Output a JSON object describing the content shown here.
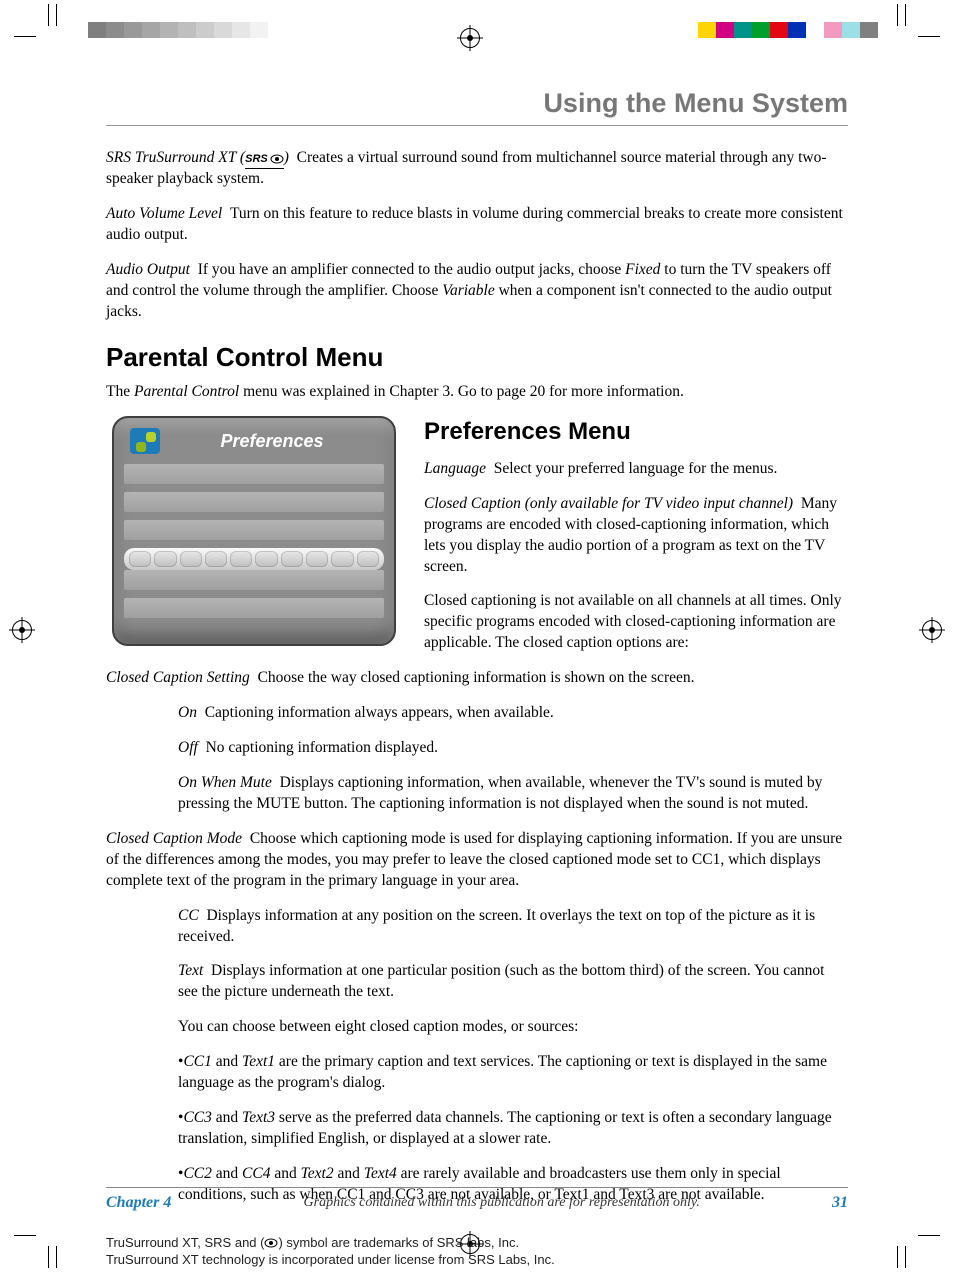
{
  "header": {
    "title": "Using the Menu System"
  },
  "top": {
    "srs_lead": "SRS TruSurround XT (",
    "srs_logo_text": "SRS",
    "srs_tail": ")",
    "srs_body": "Creates a virtual surround sound from multichannel source material through any two-speaker playback system.",
    "avl_lead": "Auto Volume Level",
    "avl_body": "Turn on this feature to reduce blasts in volume during commercial breaks to create more consistent audio output.",
    "ao_lead": "Audio Output",
    "ao_body1": "If you have an amplifier connected to the audio output jacks, choose ",
    "ao_fixed": "Fixed",
    "ao_body2": " to turn the TV speakers off and control the volume through the amplifier. Choose ",
    "ao_variable": "Variable",
    "ao_body3": " when a component isn't connected to the audio output jacks."
  },
  "parental": {
    "heading": "Parental Control Menu",
    "p1a": "The ",
    "p1b": "Parental Control",
    "p1c": " menu was explained in Chapter 3. Go to page 20 for more information."
  },
  "osd": {
    "title": "Preferences"
  },
  "prefs": {
    "heading": "Preferences Menu",
    "lang_lead": "Language",
    "lang_body": "Select your preferred language for the menus.",
    "cc_lead": "Closed Caption (only available for TV video input channel)",
    "cc_body": "Many programs are encoded with closed-captioning information, which lets you display the audio portion of a program as text on the TV screen.",
    "cc_p2": "Closed captioning is not available on all channels at all times. Only specific programs encoded with closed-captioning information are applicable. The closed caption options are:"
  },
  "ccset": {
    "lead": "Closed Caption Setting",
    "body": "Choose the way closed captioning information is shown on the screen.",
    "on_lead": "On",
    "on_body": "Captioning information always appears, when available.",
    "off_lead": "Off",
    "off_body": "No captioning information displayed.",
    "owm_lead": "On When Mute",
    "owm_body": "Displays captioning information, when available, whenever the TV's sound is muted by pressing the MUTE button. The captioning information is not displayed when the sound is not muted."
  },
  "ccmode": {
    "lead": "Closed Caption Mode",
    "body": "Choose which captioning mode is used for displaying captioning information. If you are unsure of the differences among the modes, you may prefer to leave the closed captioned mode set to CC1, which displays complete text of the program in the primary language in your area.",
    "cc_lead": "CC",
    "cc_body": "Displays information at any position on the screen. It overlays the text on top of the picture as it is received.",
    "text_lead": "Text",
    "text_body": "Displays information at one particular position (such as the bottom third) of the screen. You cannot see the picture underneath the text.",
    "choose": "You can choose between eight closed caption modes, or sources:",
    "b1a": "CC1",
    "b1b": "Text1",
    "b1c": " are the primary caption and text services. The captioning or text is displayed in the same language as the program's dialog.",
    "b2a": "CC3",
    "b2b": "Text3",
    "b2c": " serve as the preferred data channels. The captioning or text is often a secondary language translation, simplified English, or displayed at a slower rate.",
    "b3a": "CC2",
    "b3b": "CC4",
    "b3c": "Text2",
    "b3d": "Text4",
    "b3e": " are rarely available and broadcasters use them only in special conditions, such as when CC1 and CC3 are not available, or Text1 and Text3 are not available."
  },
  "notes": {
    "l1a": "TruSurround XT, SRS and (",
    "l1b": ") symbol are trademarks of SRS labs, Inc.",
    "l2": "TruSurround XT technology is incorporated under license from SRS Labs, Inc."
  },
  "footer": {
    "chapter": "Chapter 4",
    "mid": "Graphics contained within this publication are for representation only.",
    "page": "31"
  },
  "greybar": [
    "#7f7f7f",
    "#8c8c8c",
    "#999999",
    "#a6a6a6",
    "#b3b3b3",
    "#bfbfbf",
    "#cccccc",
    "#d9d9d9",
    "#e6e6e6",
    "#f2f2f2",
    "#ffffff"
  ],
  "colorbar": [
    "#ffd400",
    "#d10082",
    "#00938a",
    "#009e2a",
    "#e30613",
    "#0030b4",
    "#ffffff",
    "#f29ac0",
    "#9be0e6",
    "#808080"
  ]
}
